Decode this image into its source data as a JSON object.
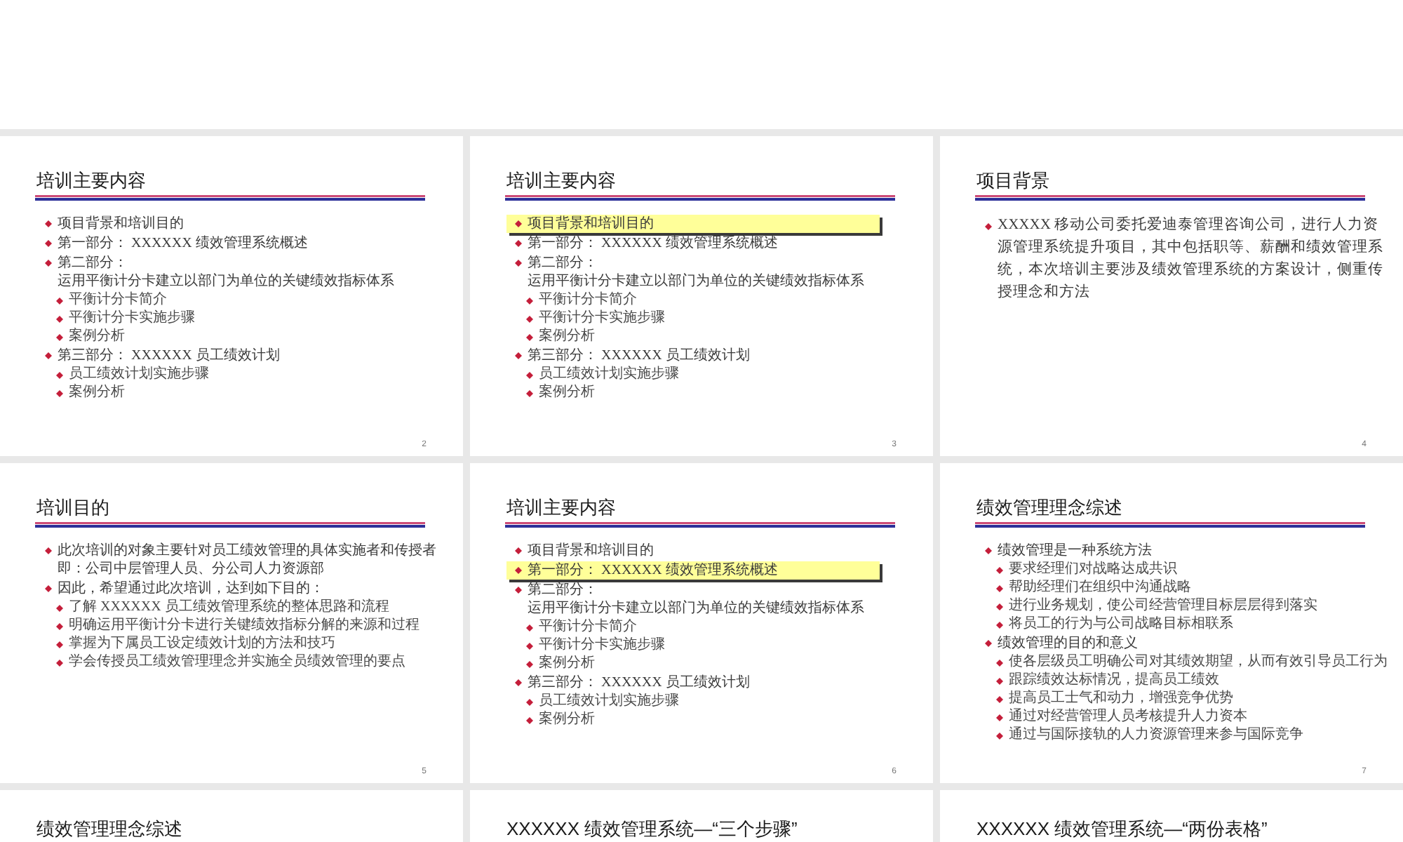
{
  "slides": [
    {
      "kind": "list",
      "title": "培训主要内容",
      "number": "2",
      "items": [
        {
          "text": "项目背景和培训目的",
          "highlighted": false
        },
        {
          "text": "第一部分： XXXXXX 绩效管理系统概述",
          "highlighted": false
        },
        {
          "text": "第二部分：",
          "second_line": "运用平衡计分卡建立以部门为单位的关键绩效指标体系",
          "highlighted": false,
          "children": [
            {
              "text": "平衡计分卡简介"
            },
            {
              "text": "平衡计分卡实施步骤"
            },
            {
              "text": "案例分析"
            }
          ]
        },
        {
          "text": "第三部分： XXXXXX 员工绩效计划",
          "highlighted": false,
          "children": [
            {
              "text": "员工绩效计划实施步骤"
            },
            {
              "text": "案例分析"
            }
          ]
        }
      ]
    },
    {
      "kind": "list",
      "title": "培训主要内容",
      "number": "3",
      "items": [
        {
          "text": "项目背景和培训目的",
          "highlighted": true
        },
        {
          "text": "第一部分： XXXXXX 绩效管理系统概述",
          "highlighted": false
        },
        {
          "text": "第二部分：",
          "second_line": "运用平衡计分卡建立以部门为单位的关键绩效指标体系",
          "highlighted": false,
          "children": [
            {
              "text": "平衡计分卡简介"
            },
            {
              "text": "平衡计分卡实施步骤"
            },
            {
              "text": "案例分析"
            }
          ]
        },
        {
          "text": "第三部分： XXXXXX 员工绩效计划",
          "highlighted": false,
          "children": [
            {
              "text": "员工绩效计划实施步骤"
            },
            {
              "text": "案例分析"
            }
          ]
        }
      ]
    },
    {
      "kind": "paragraph",
      "title": "项目背景",
      "number": "4",
      "items": [
        {
          "text": "XXXXX 移动公司委托爱迪泰管理咨询公司，进行人力资源管理系统提升项目，其中包括职等、薪酬和绩效管理系统，本次培训主要涉及绩效管理系统的方案设计，侧重传授理念和方法"
        }
      ]
    },
    {
      "kind": "list",
      "title": "培训目的",
      "number": "5",
      "items": [
        {
          "text": "此次培训的对象主要针对员工绩效管理的具体实施者和传授者",
          "second_line": "即：公司中层管理人员、分公司人力资源部"
        },
        {
          "text": "因此，希望通过此次培训，达到如下目的：",
          "children": [
            {
              "text": "了解 XXXXXX 员工绩效管理系统的整体思路和流程"
            },
            {
              "text": "明确运用平衡计分卡进行关键绩效指标分解的来源和过程"
            },
            {
              "text": "掌握为下属员工设定绩效计划的方法和技巧"
            },
            {
              "text": "学会传授员工绩效管理理念并实施全员绩效管理的要点"
            }
          ]
        }
      ]
    },
    {
      "kind": "list",
      "title": "培训主要内容",
      "number": "6",
      "items": [
        {
          "text": "项目背景和培训目的",
          "highlighted": false
        },
        {
          "text": "第一部分： XXXXXX 绩效管理系统概述",
          "highlighted": true
        },
        {
          "text": "第二部分：",
          "second_line": "运用平衡计分卡建立以部门为单位的关键绩效指标体系",
          "highlighted": false,
          "children": [
            {
              "text": "平衡计分卡简介"
            },
            {
              "text": "平衡计分卡实施步骤"
            },
            {
              "text": "案例分析"
            }
          ]
        },
        {
          "text": "第三部分： XXXXXX 员工绩效计划",
          "highlighted": false,
          "children": [
            {
              "text": "员工绩效计划实施步骤"
            },
            {
              "text": "案例分析"
            }
          ]
        }
      ]
    },
    {
      "kind": "list",
      "title": "绩效管理理念综述",
      "number": "7",
      "items": [
        {
          "text": "绩效管理是一种系统方法",
          "children": [
            {
              "text": "要求经理们对战略达成共识"
            },
            {
              "text": "帮助经理们在组织中沟通战略"
            },
            {
              "text": "进行业务规划，使公司经营管理目标层层得到落实"
            },
            {
              "text": "将员工的行为与公司战略目标相联系"
            }
          ]
        },
        {
          "text": "绩效管理的目的和意义",
          "children": [
            {
              "text": "使各层级员工明确公司对其绩效期望，从而有效引导员工行为"
            },
            {
              "text": "跟踪绩效达标情况，提高员工绩效"
            },
            {
              "text": "提高员工士气和动力，增强竞争优势"
            },
            {
              "text": "通过对经营管理人员考核提升人力资本"
            },
            {
              "text": "通过与国际接轨的人力资源管理来参与国际竞争"
            }
          ]
        }
      ]
    },
    {
      "kind": "cut_off",
      "title": "绩效管理理念综述"
    },
    {
      "kind": "cut_off",
      "title": "XXXXXX 绩效管理系统—“三个步骤”"
    },
    {
      "kind": "cut_off",
      "title": "XXXXXX 绩效管理系统—“两份表格”"
    }
  ]
}
